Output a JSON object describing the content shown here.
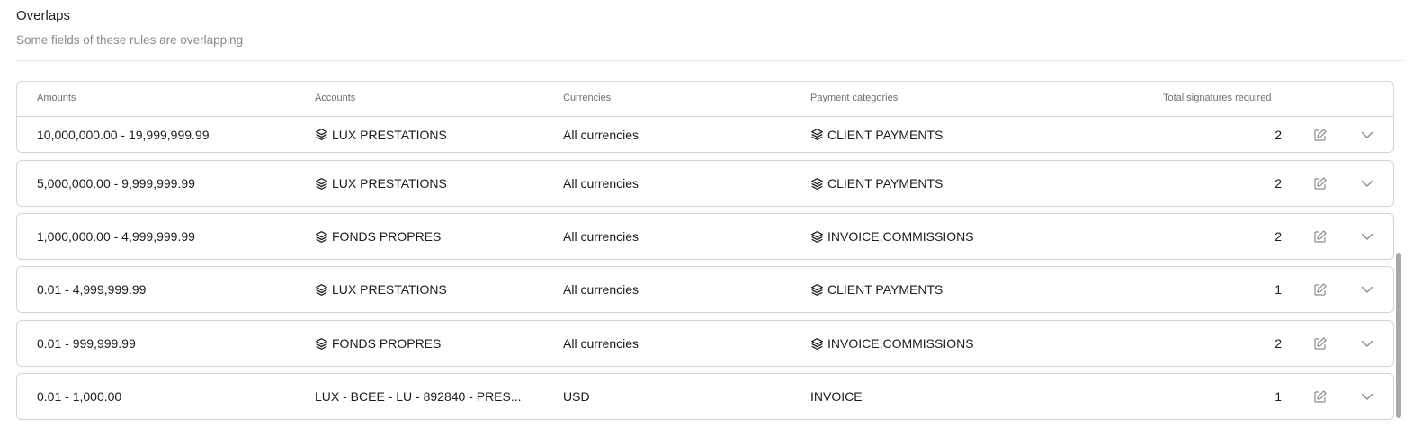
{
  "section": {
    "title": "Overlaps",
    "subtitle": "Some fields of these rules are overlapping"
  },
  "table": {
    "headers": {
      "amounts": "Amounts",
      "accounts": "Accounts",
      "currencies": "Currencies",
      "payment_categories": "Payment categories",
      "total_signatures": "Total signatures required"
    },
    "rows": [
      {
        "amount": "10,000,000.00 - 19,999,999.99",
        "account": "LUX PRESTATIONS",
        "account_icon": "layers-icon",
        "currency": "All currencies",
        "category": "CLIENT PAYMENTS",
        "category_icon": "layers-icon",
        "signatures": "2"
      },
      {
        "amount": "5,000,000.00 - 9,999,999.99",
        "account": "LUX PRESTATIONS",
        "account_icon": "layers-icon",
        "currency": "All currencies",
        "category": "CLIENT PAYMENTS",
        "category_icon": "layers-icon",
        "signatures": "2"
      },
      {
        "amount": "1,000,000.00 - 4,999,999.99",
        "account": "FONDS PROPRES",
        "account_icon": "layers-icon",
        "currency": "All currencies",
        "category": "INVOICE,COMMISSIONS",
        "category_icon": "layers-icon",
        "signatures": "2"
      },
      {
        "amount": "0.01 - 4,999,999.99",
        "account": "LUX PRESTATIONS",
        "account_icon": "layers-icon",
        "currency": "All currencies",
        "category": "CLIENT PAYMENTS",
        "category_icon": "layers-icon",
        "signatures": "1"
      },
      {
        "amount": "0.01 - 999,999.99",
        "account": "FONDS PROPRES",
        "account_icon": "layers-icon",
        "currency": "All currencies",
        "category": "INVOICE,COMMISSIONS",
        "category_icon": "layers-icon",
        "signatures": "2"
      },
      {
        "amount": "0.01 - 1,000.00",
        "account": "LUX - BCEE - LU - 892840 - PRES...",
        "account_icon": null,
        "currency": "USD",
        "category": "INVOICE",
        "category_icon": null,
        "signatures": "1"
      }
    ],
    "row_actions": {
      "edit_icon": "edit-icon",
      "expand_icon": "chevron-down-icon"
    }
  },
  "colors": {
    "border": "#d4d4d4",
    "header_text": "#6f6f6f",
    "subtitle_text": "#8a8a8a",
    "icon": "#8c8c8c",
    "scrollbar": "#a8a8a8"
  }
}
